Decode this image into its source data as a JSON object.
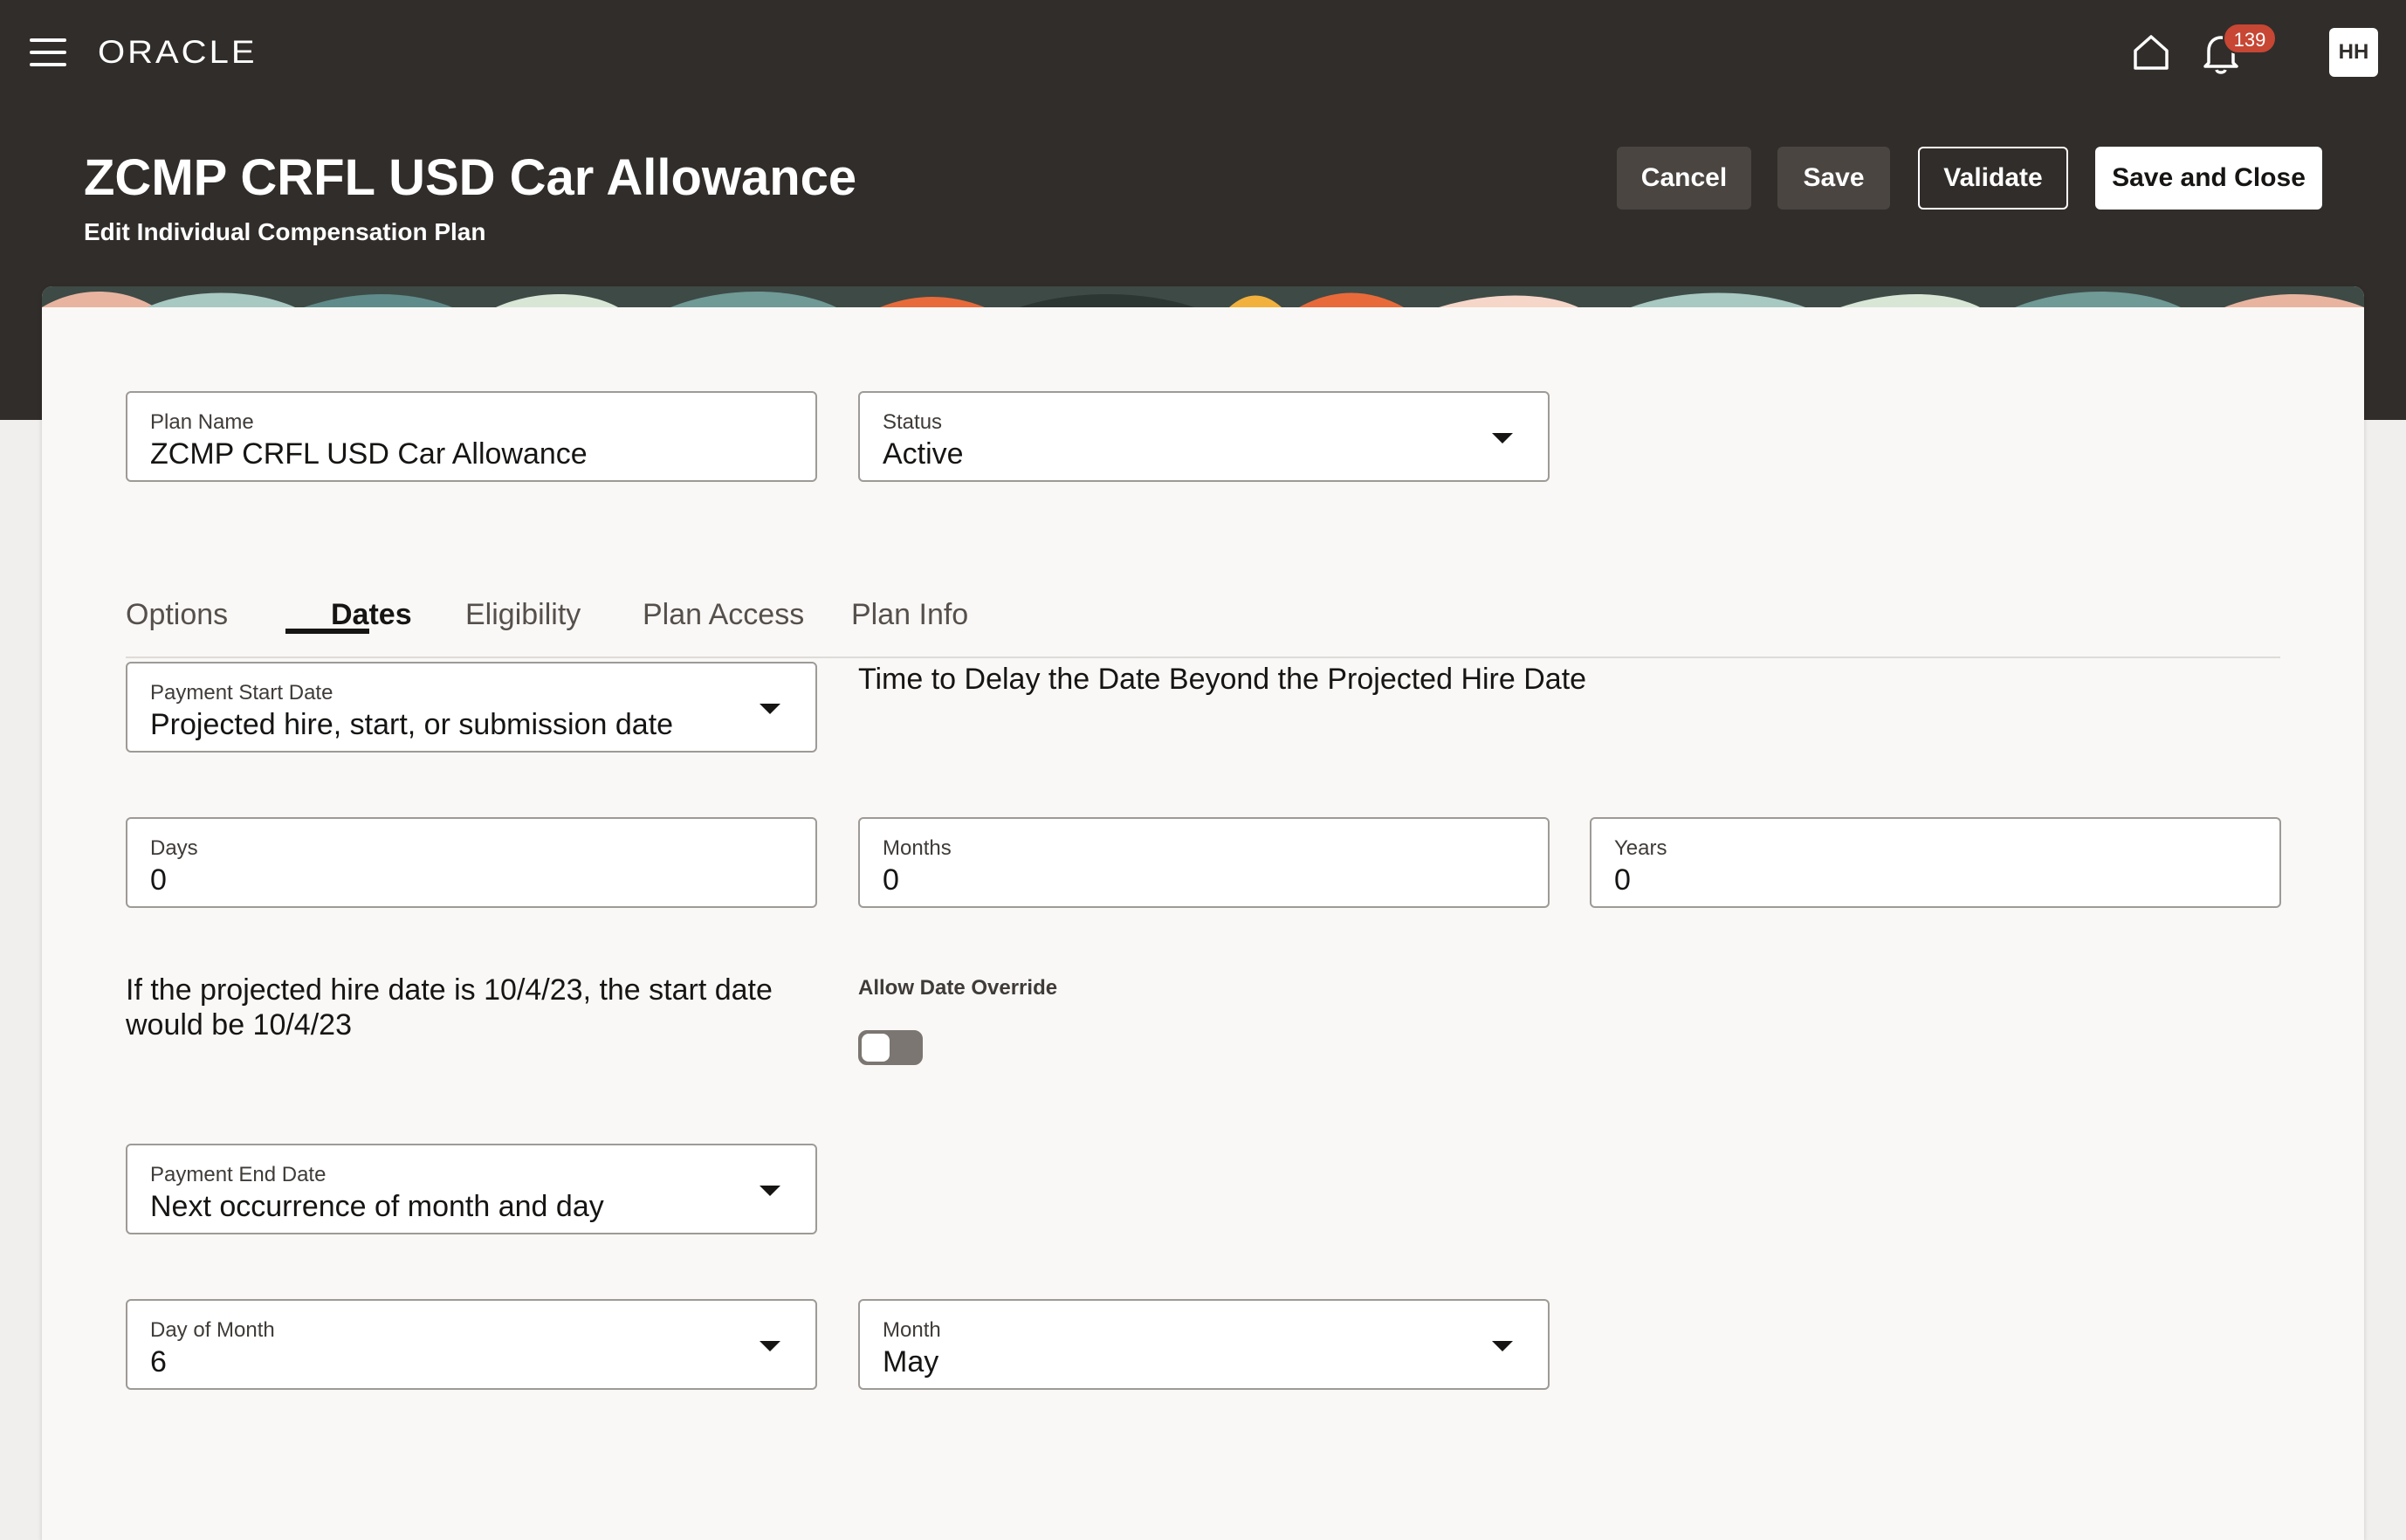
{
  "header": {
    "brand": "ORACLE",
    "notification_count": "139",
    "avatar_initials": "HH",
    "title": "ZCMP CRFL USD Car Allowance",
    "subtitle": "Edit Individual Compensation Plan",
    "buttons": {
      "cancel": "Cancel",
      "save": "Save",
      "validate": "Validate",
      "save_and_close": "Save and Close"
    },
    "icons": [
      "menu-icon",
      "home-icon",
      "bell-icon"
    ]
  },
  "form": {
    "plan_name": {
      "label": "Plan Name",
      "value": "ZCMP CRFL USD Car Allowance"
    },
    "status": {
      "label": "Status",
      "value": "Active"
    }
  },
  "tabs": [
    {
      "label": "Options"
    },
    {
      "label": "Dates",
      "active": true
    },
    {
      "label": "Eligibility"
    },
    {
      "label": "Plan Access"
    },
    {
      "label": "Plan Info"
    }
  ],
  "dates": {
    "payment_start_date": {
      "label": "Payment Start Date",
      "value": "Projected hire, start, or submission date"
    },
    "delay_heading": "Time to Delay the Date Beyond the Projected Hire Date",
    "days": {
      "label": "Days",
      "value": "0"
    },
    "months": {
      "label": "Months",
      "value": "0"
    },
    "years": {
      "label": "Years",
      "value": "0"
    },
    "hint": "If the projected hire date is 10/4/23, the start date would be 10/4/23",
    "allow_override": {
      "label": "Allow Date Override",
      "on": false
    },
    "payment_end_date": {
      "label": "Payment End Date",
      "value": "Next occurrence of month and day"
    },
    "day_of_month": {
      "label": "Day of Month",
      "value": "6"
    },
    "month": {
      "label": "Month",
      "value": "May"
    }
  },
  "colors": {
    "header_bg": "#312d2a",
    "card_bg": "#f9f8f6",
    "badge": "#c74634",
    "banner_accent_orange": "#e86a3a",
    "banner_accent_teal": "#5f8c8a"
  }
}
